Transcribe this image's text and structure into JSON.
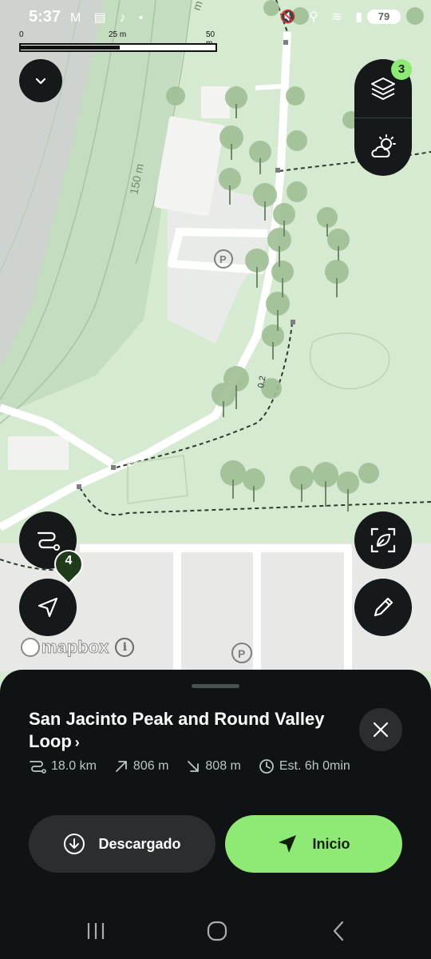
{
  "status_bar": {
    "time": "5:37",
    "left_icons": "M ▤ ♪ •",
    "right_icons": "🔇 ⚲ ≋ ▮",
    "battery": "79"
  },
  "map": {
    "scale_labels": [
      "0",
      "25 m",
      "50 m"
    ],
    "contour_label": "150 m",
    "contour_label_top": "m",
    "trail_label": "0.2",
    "layers_badge": "3",
    "waypoint_number": "4",
    "attribution": "mapbox",
    "info_icon_text": "i",
    "parking_label": "P"
  },
  "route_sheet": {
    "title": "San Jacinto Peak and Round Valley Loop",
    "title_chevron": "›",
    "stats": {
      "distance": "18.0 km",
      "ascent": "806 m",
      "descent": "808 m",
      "duration": "Est. 6h 0min"
    },
    "download_label": "Descargado",
    "start_label": "Inicio"
  },
  "colors": {
    "accent": "#8eea74",
    "sheet_bg": "#101313",
    "map_park": "#d6ead1",
    "map_road": "#ffffff",
    "button_bg": "#15191a"
  }
}
